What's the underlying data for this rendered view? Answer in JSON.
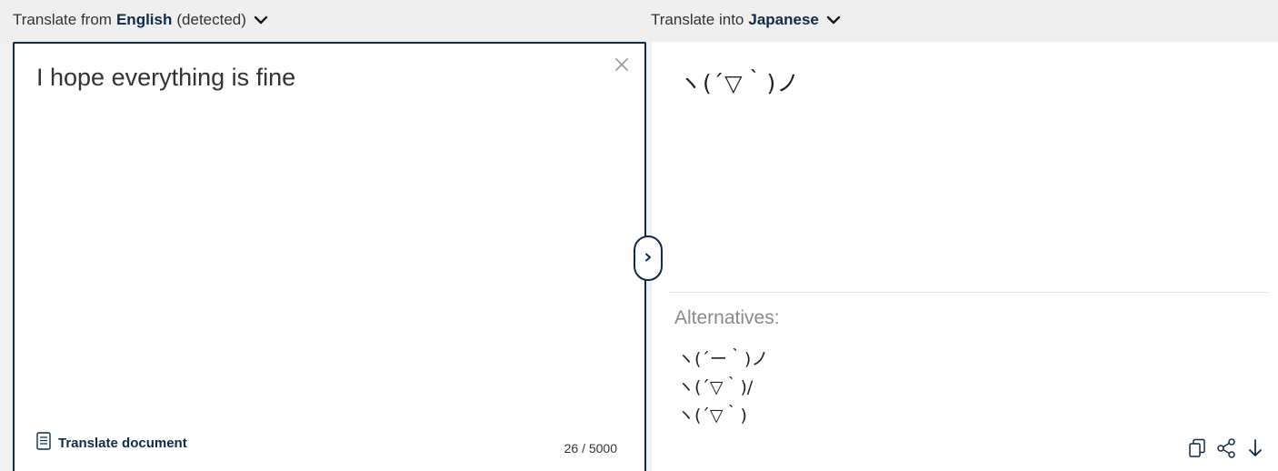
{
  "source": {
    "prefix": "Translate from",
    "language": "English",
    "detected_note": "(detected)",
    "text": "I hope everything is fine",
    "translate_document_label": "Translate document",
    "char_count": "26 / 5000"
  },
  "target": {
    "prefix": "Translate into",
    "language": "Japanese",
    "translation": "ヽ(´▽｀)ノ",
    "alternatives_heading": "Alternatives:",
    "alternatives": [
      "ヽ(´ー｀)ノ",
      "ヽ(´▽｀)/",
      "ヽ(´▽｀)"
    ]
  },
  "icons": {
    "source_dropdown": "chevron-down-icon",
    "target_dropdown": "chevron-down-icon",
    "clear": "close-icon",
    "document": "document-icon",
    "swap": "chevron-right-icon",
    "copy": "copy-icon",
    "share": "share-icon",
    "download": "download-icon"
  },
  "colors": {
    "accent_navy": "#0f2b46",
    "bar_background": "#efefef",
    "panel_background": "#ffffff"
  }
}
